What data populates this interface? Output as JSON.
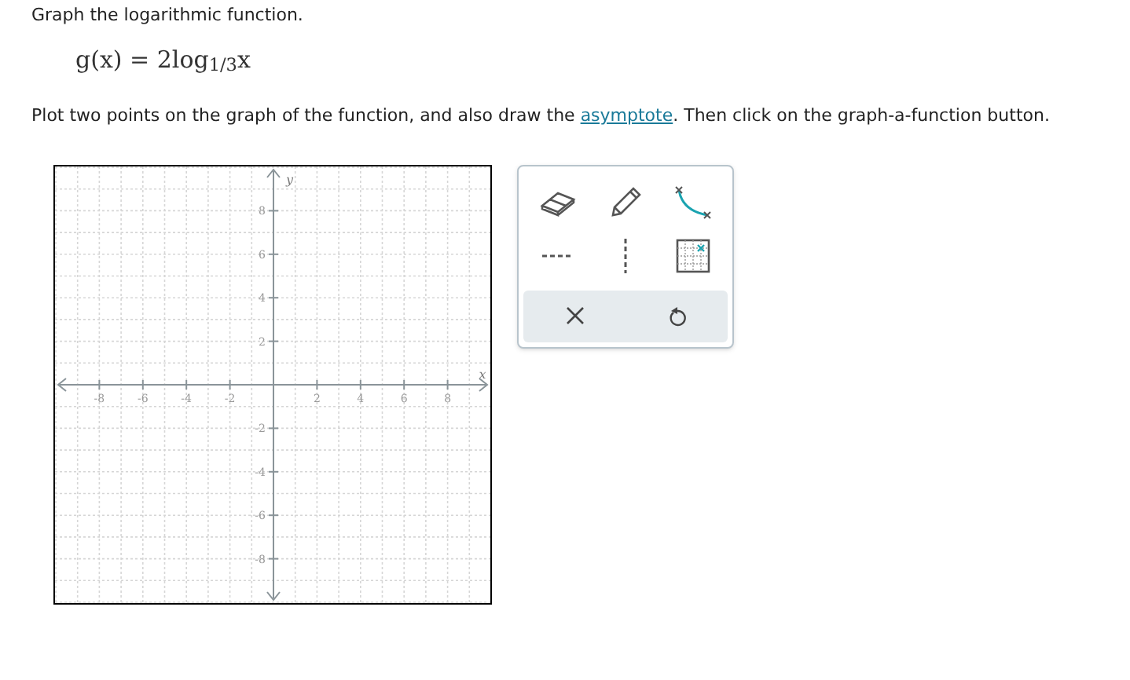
{
  "prompt": "Graph the logarithmic function.",
  "equation": "g(x) = 2log$_{1/3}$x",
  "instruction": {
    "before": "Plot two points on the graph of the function, and also draw the ",
    "link": "asymptote",
    "after": ". Then click on the graph-a-function button."
  },
  "graph": {
    "x_label": "x",
    "y_label": "y",
    "x_ticks": [
      "-8",
      "-6",
      "-4",
      "-2",
      "2",
      "4",
      "6",
      "8"
    ],
    "y_ticks": [
      "8",
      "6",
      "4",
      "2",
      "-2",
      "-4",
      "-6",
      "-8"
    ]
  },
  "tools": [
    {
      "kind": "eraser"
    },
    {
      "kind": "pencil"
    },
    {
      "kind": "curve"
    },
    {
      "kind": "hline"
    },
    {
      "kind": "vline"
    },
    {
      "kind": "graph"
    }
  ],
  "actions": [
    {
      "kind": "clear"
    },
    {
      "kind": "undo"
    }
  ]
}
